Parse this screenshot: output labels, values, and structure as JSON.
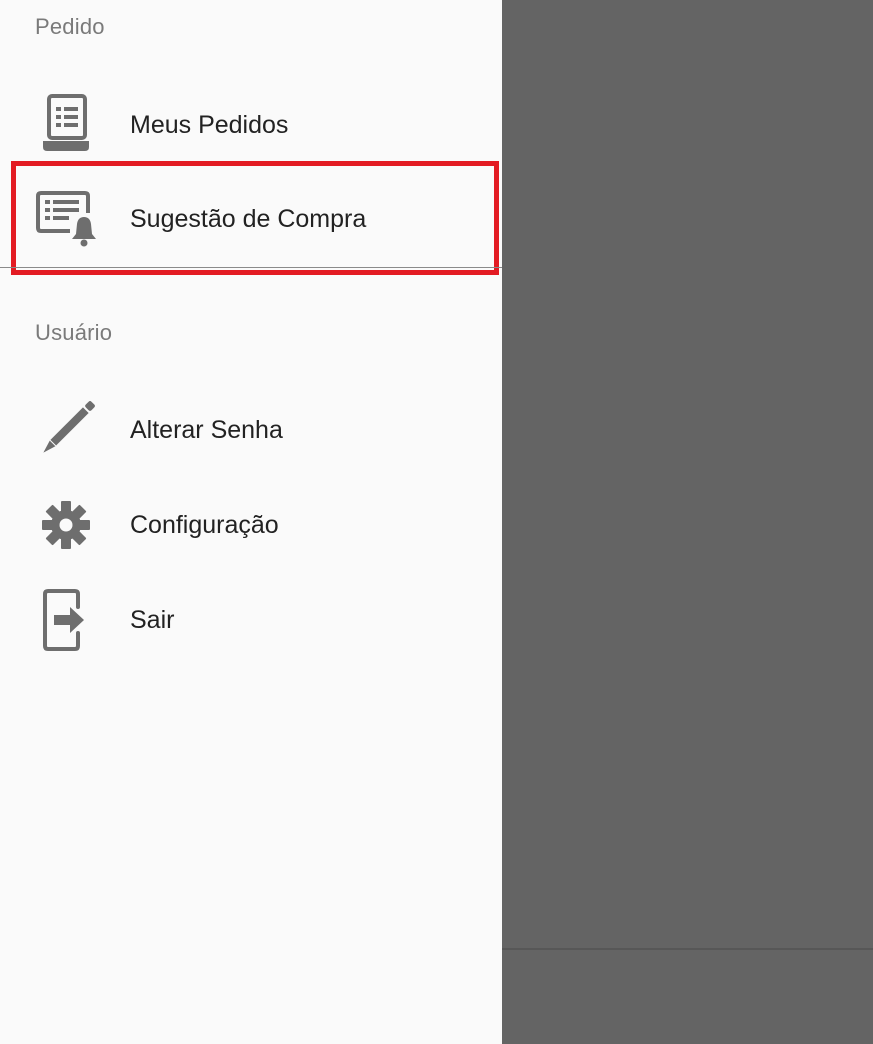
{
  "drawer": {
    "sections": [
      {
        "header": "Pedido",
        "items": [
          {
            "label": "Meus Pedidos",
            "icon": "receipt-list-icon"
          },
          {
            "label": "Sugestão de Compra",
            "icon": "list-bell-icon"
          }
        ]
      },
      {
        "header": "Usuário",
        "items": [
          {
            "label": "Alterar Senha",
            "icon": "pencil-icon"
          },
          {
            "label": "Configuração",
            "icon": "gear-icon"
          },
          {
            "label": "Sair",
            "icon": "exit-icon"
          }
        ]
      }
    ]
  },
  "colors": {
    "highlight": "#e31b23",
    "icon": "#6e6e6e",
    "scrim": "#646464"
  }
}
